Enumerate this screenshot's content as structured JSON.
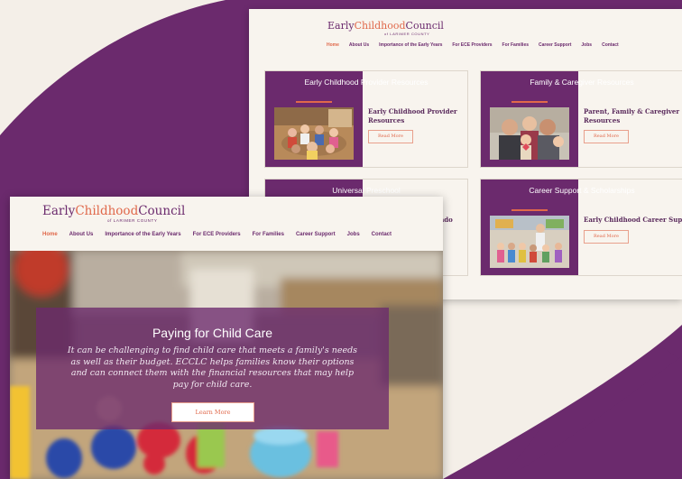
{
  "colors": {
    "purple": "#6b2a6d",
    "coral": "#e0684a",
    "cream": "#f8f4ee"
  },
  "brand": {
    "part1": "Early",
    "part2": "Childhood",
    "part3": "Council",
    "tagline": "of LARIMER COUNTY"
  },
  "nav": {
    "items": [
      "Home",
      "About Us",
      "Importance of the Early Years",
      "For ECE Providers",
      "For Families",
      "Career Support",
      "Jobs",
      "Contact"
    ],
    "active": "Home"
  },
  "cards": [
    {
      "panel_title": "Early Childhood Provider Resources",
      "title_lines": [
        "Early Childhood Provider",
        "Resources"
      ],
      "button": "Read More"
    },
    {
      "panel_title": "Family & Caregiver Resources",
      "title_lines": [
        "Parent, Family & Caregiver",
        "Resources"
      ],
      "button": "Read More"
    },
    {
      "panel_title": "Universal Preschool",
      "title_lines": [
        "rado"
      ],
      "button": ""
    },
    {
      "panel_title": "Career Support & Scholarships",
      "title_lines": [
        "Early Childhood Career Support"
      ],
      "button": "Read More"
    }
  ],
  "hero": {
    "heading": "Paying for Child Care",
    "body": "It can be challenging to find child care that meets a family's needs as well as their budget. ECCLC helps families know their options and can connect them with the financial resources that may help pay for child care.",
    "button": "Learn More"
  }
}
